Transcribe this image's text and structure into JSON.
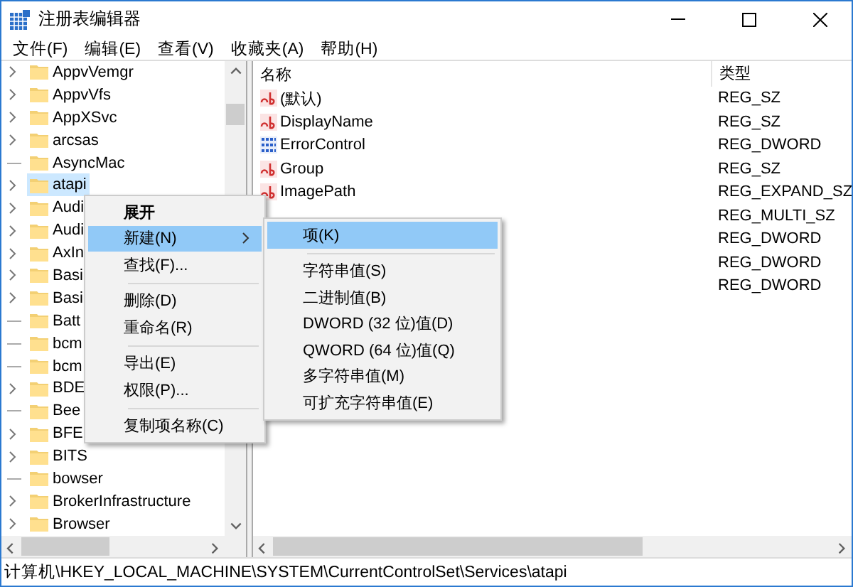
{
  "window": {
    "title": "注册表编辑器"
  },
  "menu_bar": [
    "文件(F)",
    "编辑(E)",
    "查看(V)",
    "收藏夹(A)",
    "帮助(H)"
  ],
  "tree": {
    "items": [
      {
        "label": "AppvVemgr",
        "expandable": true,
        "selected": false
      },
      {
        "label": "AppvVfs",
        "expandable": true,
        "selected": false
      },
      {
        "label": "AppXSvc",
        "expandable": true,
        "selected": false
      },
      {
        "label": "arcsas",
        "expandable": true,
        "selected": false
      },
      {
        "label": "AsyncMac",
        "expandable": false,
        "selected": false
      },
      {
        "label": "atapi",
        "expandable": true,
        "selected": true
      },
      {
        "label": "Audi",
        "expandable": true,
        "selected": false
      },
      {
        "label": "Audi",
        "expandable": true,
        "selected": false
      },
      {
        "label": "AxIn",
        "expandable": true,
        "selected": false
      },
      {
        "label": "Basi",
        "expandable": true,
        "selected": false
      },
      {
        "label": "Basi",
        "expandable": true,
        "selected": false
      },
      {
        "label": "Batt",
        "expandable": false,
        "selected": false
      },
      {
        "label": "bcm",
        "expandable": false,
        "selected": false
      },
      {
        "label": "bcm",
        "expandable": false,
        "selected": false
      },
      {
        "label": "BDE",
        "expandable": true,
        "selected": false
      },
      {
        "label": "Bee",
        "expandable": false,
        "selected": false
      },
      {
        "label": "BFE",
        "expandable": true,
        "selected": false
      },
      {
        "label": "BITS",
        "expandable": true,
        "selected": false
      },
      {
        "label": "bowser",
        "expandable": false,
        "selected": false
      },
      {
        "label": "BrokerInfrastructure",
        "expandable": true,
        "selected": false
      },
      {
        "label": "Browser",
        "expandable": true,
        "selected": false
      }
    ]
  },
  "values": {
    "columns": [
      "名称",
      "类型"
    ],
    "rows": [
      {
        "name": "(默认)",
        "kind": "string",
        "type": "REG_SZ"
      },
      {
        "name": "DisplayName",
        "kind": "string",
        "type": "REG_SZ"
      },
      {
        "name": "ErrorControl",
        "kind": "binary",
        "type": "REG_DWORD"
      },
      {
        "name": "Group",
        "kind": "string",
        "type": "REG_SZ"
      },
      {
        "name": "ImagePath",
        "kind": "string",
        "type": "REG_EXPAND_SZ"
      },
      {
        "type": "REG_MULTI_SZ"
      },
      {
        "type": "REG_DWORD"
      },
      {
        "type": "REG_DWORD"
      },
      {
        "type": "REG_DWORD"
      }
    ]
  },
  "context_menu": {
    "items": [
      {
        "kind": "default",
        "label": "展开",
        "selected": false
      },
      {
        "kind": "submenu",
        "label": "新建(N)",
        "selected": true
      },
      {
        "kind": "item",
        "label": "查找(F)...",
        "selected": false
      },
      {
        "kind": "separator"
      },
      {
        "kind": "item",
        "label": "删除(D)",
        "selected": false
      },
      {
        "kind": "item",
        "label": "重命名(R)",
        "selected": false
      },
      {
        "kind": "separator"
      },
      {
        "kind": "item",
        "label": "导出(E)",
        "selected": false
      },
      {
        "kind": "item",
        "label": "权限(P)...",
        "selected": false
      },
      {
        "kind": "separator"
      },
      {
        "kind": "item",
        "label": "复制项名称(C)",
        "selected": false
      }
    ]
  },
  "submenu": {
    "items": [
      {
        "kind": "item",
        "label": "项(K)",
        "selected": true
      },
      {
        "kind": "separator"
      },
      {
        "kind": "item",
        "label": "字符串值(S)",
        "selected": false
      },
      {
        "kind": "item",
        "label": "二进制值(B)",
        "selected": false
      },
      {
        "kind": "item",
        "label": "DWORD (32 位)值(D)",
        "selected": false
      },
      {
        "kind": "item",
        "label": "QWORD (64 位)值(Q)",
        "selected": false
      },
      {
        "kind": "item",
        "label": "多字符串值(M)",
        "selected": false
      },
      {
        "kind": "item",
        "label": "可扩充字符串值(E)",
        "selected": false
      }
    ]
  },
  "status_bar": {
    "path": "计算机\\HKEY_LOCAL_MACHINE\\SYSTEM\\CurrentControlSet\\Services\\atapi"
  }
}
